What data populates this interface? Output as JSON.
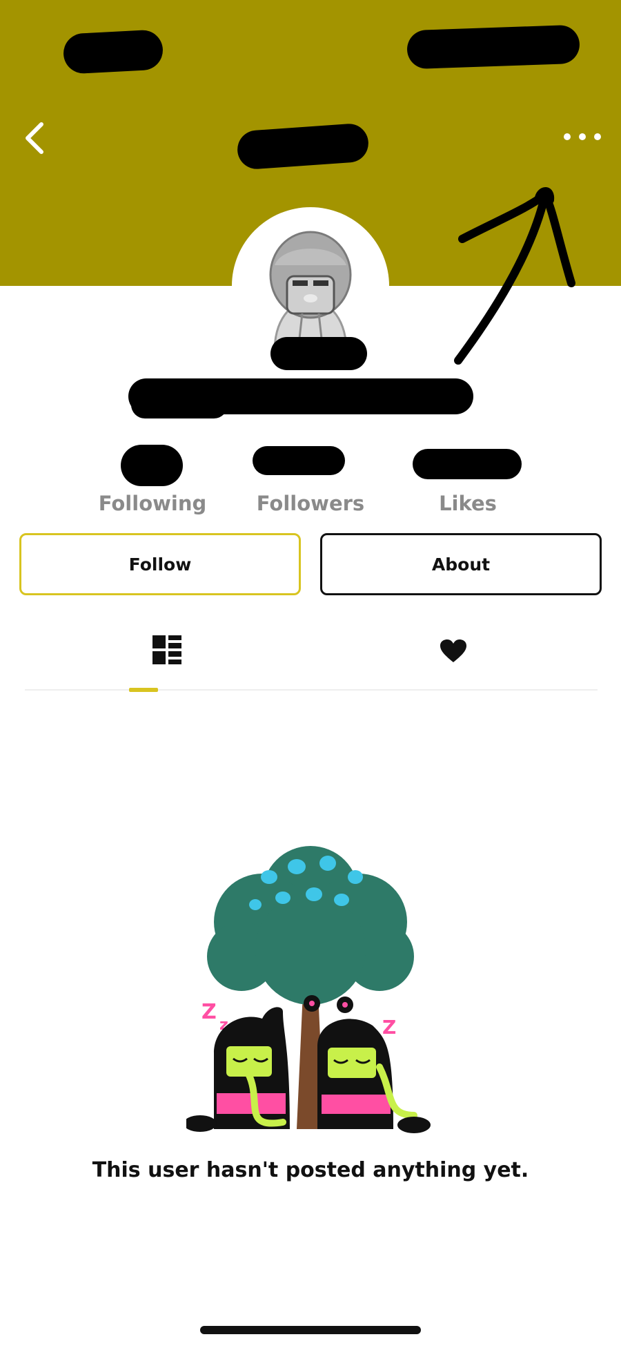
{
  "header": {
    "background_color": "#a39400",
    "back_icon": "chevron-left-icon",
    "more_icon": "more-horizontal-icon"
  },
  "stats": [
    {
      "label": "Following"
    },
    {
      "label": "Followers"
    },
    {
      "label": "Likes"
    }
  ],
  "actions": {
    "follow_label": "Follow",
    "about_label": "About",
    "accent_color": "#d8c420"
  },
  "tabs": [
    {
      "icon": "grid-icon",
      "active": true
    },
    {
      "icon": "heart-icon",
      "active": false
    }
  ],
  "empty_state": {
    "message": "This user hasn't posted anything yet."
  }
}
